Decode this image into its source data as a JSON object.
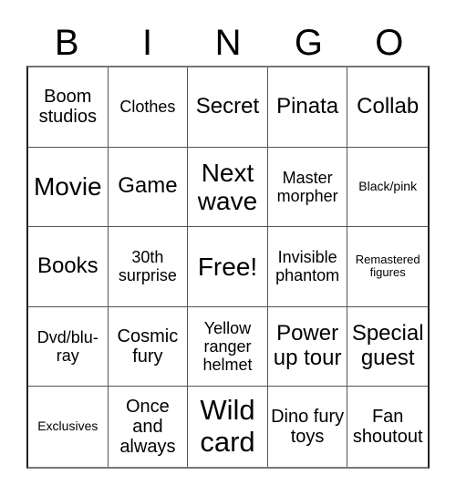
{
  "header": {
    "letters": [
      "B",
      "I",
      "N",
      "G",
      "O"
    ]
  },
  "card": {
    "rows": [
      [
        "Boom studios",
        "Clothes",
        "Secret",
        "Pinata",
        "Collab"
      ],
      [
        "Movie",
        "Game",
        "Next wave",
        "Master morpher",
        "Black/pink"
      ],
      [
        "Books",
        "30th surprise",
        "Free!",
        "Invisible phantom",
        "Remastered figures"
      ],
      [
        "Dvd/blu-ray",
        "Cosmic fury",
        "Yellow ranger helmet",
        "Power up tour",
        "Special guest"
      ],
      [
        "Exclusives",
        "Once and always",
        "Wild card",
        "Dino fury toys",
        "Fan shoutout"
      ]
    ]
  }
}
